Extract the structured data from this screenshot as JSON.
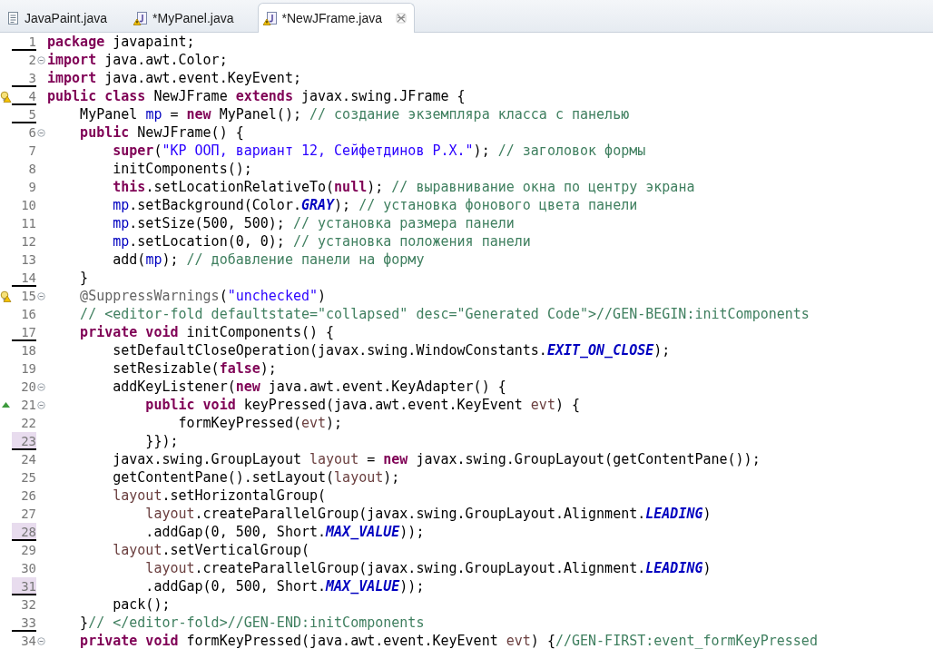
{
  "tabs": [
    {
      "label": "JavaPaint.java",
      "kind": "plain",
      "selected": false,
      "closable": false
    },
    {
      "label": "*MyPanel.java",
      "kind": "java",
      "selected": false,
      "closable": false
    },
    {
      "label": "*NewJFrame.java",
      "kind": "java",
      "selected": true,
      "closable": true
    }
  ],
  "editor": {
    "lines": [
      {
        "number": "1",
        "deletion_below": true,
        "changed": false,
        "foldable": false,
        "warning": false,
        "override": false,
        "segments": [
          {
            "kind": "keyword",
            "text": "package"
          },
          {
            "kind": "text",
            "text": " javapaint;"
          }
        ]
      },
      {
        "number": "2",
        "deletion_below": false,
        "changed": false,
        "foldable": true,
        "warning": false,
        "override": false,
        "segments": [
          {
            "kind": "keyword",
            "text": "import"
          },
          {
            "kind": "text",
            "text": " java.awt.Color;"
          }
        ]
      },
      {
        "number": "3",
        "deletion_below": true,
        "changed": false,
        "foldable": false,
        "warning": false,
        "override": false,
        "segments": [
          {
            "kind": "keyword",
            "text": "import"
          },
          {
            "kind": "text",
            "text": " java.awt.event.KeyEvent;"
          }
        ]
      },
      {
        "number": "4",
        "deletion_below": true,
        "changed": false,
        "foldable": false,
        "warning": true,
        "override": false,
        "segments": [
          {
            "kind": "keyword",
            "text": "public class"
          },
          {
            "kind": "text",
            "text": " NewJFrame "
          },
          {
            "kind": "keyword",
            "text": "extends"
          },
          {
            "kind": "text",
            "text": " javax.swing.JFrame {"
          }
        ]
      },
      {
        "number": "5",
        "deletion_below": true,
        "changed": false,
        "foldable": false,
        "warning": false,
        "override": false,
        "segments": [
          {
            "kind": "text",
            "text": "    MyPanel "
          },
          {
            "kind": "field",
            "text": "mp"
          },
          {
            "kind": "text",
            "text": " = "
          },
          {
            "kind": "keyword",
            "text": "new"
          },
          {
            "kind": "text",
            "text": " MyPanel(); "
          },
          {
            "kind": "comment",
            "text": "// создание экземпляра класса с панелью"
          }
        ]
      },
      {
        "number": "6",
        "deletion_below": false,
        "changed": false,
        "foldable": true,
        "warning": false,
        "override": false,
        "segments": [
          {
            "kind": "keyword",
            "text": "    public"
          },
          {
            "kind": "text",
            "text": " NewJFrame() {"
          }
        ]
      },
      {
        "number": "7",
        "deletion_below": false,
        "changed": false,
        "foldable": false,
        "warning": false,
        "override": false,
        "segments": [
          {
            "kind": "keyword",
            "text": "        super"
          },
          {
            "kind": "text",
            "text": "("
          },
          {
            "kind": "string",
            "text": "\"КР ООП, вариант 12, Сейфетдинов Р.Х.\""
          },
          {
            "kind": "text",
            "text": "); "
          },
          {
            "kind": "comment",
            "text": "// заголовок формы"
          }
        ]
      },
      {
        "number": "8",
        "deletion_below": false,
        "changed": false,
        "foldable": false,
        "warning": false,
        "override": false,
        "segments": [
          {
            "kind": "text",
            "text": "        initComponents();"
          }
        ]
      },
      {
        "number": "9",
        "deletion_below": false,
        "changed": false,
        "foldable": false,
        "warning": false,
        "override": false,
        "segments": [
          {
            "kind": "keyword",
            "text": "        this"
          },
          {
            "kind": "text",
            "text": ".setLocationRelativeTo("
          },
          {
            "kind": "keyword",
            "text": "null"
          },
          {
            "kind": "text",
            "text": "); "
          },
          {
            "kind": "comment",
            "text": "// выравнивание окна по центру экрана"
          }
        ]
      },
      {
        "number": "10",
        "deletion_below": false,
        "changed": false,
        "foldable": false,
        "warning": false,
        "override": false,
        "segments": [
          {
            "kind": "field",
            "text": "        mp"
          },
          {
            "kind": "text",
            "text": ".setBackground(Color."
          },
          {
            "kind": "constant",
            "text": "GRAY"
          },
          {
            "kind": "text",
            "text": "); "
          },
          {
            "kind": "comment",
            "text": "// установка фонового цвета панели"
          }
        ]
      },
      {
        "number": "11",
        "deletion_below": false,
        "changed": false,
        "foldable": false,
        "warning": false,
        "override": false,
        "segments": [
          {
            "kind": "field",
            "text": "        mp"
          },
          {
            "kind": "text",
            "text": ".setSize(500, 500); "
          },
          {
            "kind": "comment",
            "text": "// установка размера панели"
          }
        ]
      },
      {
        "number": "12",
        "deletion_below": false,
        "changed": false,
        "foldable": false,
        "warning": false,
        "override": false,
        "segments": [
          {
            "kind": "field",
            "text": "        mp"
          },
          {
            "kind": "text",
            "text": ".setLocation(0, 0); "
          },
          {
            "kind": "comment",
            "text": "// установка положения панели"
          }
        ]
      },
      {
        "number": "13",
        "deletion_below": false,
        "changed": false,
        "foldable": false,
        "warning": false,
        "override": false,
        "segments": [
          {
            "kind": "text",
            "text": "        add("
          },
          {
            "kind": "field",
            "text": "mp"
          },
          {
            "kind": "text",
            "text": "); "
          },
          {
            "kind": "comment",
            "text": "// добавление панели на форму"
          }
        ]
      },
      {
        "number": "14",
        "deletion_below": true,
        "changed": false,
        "foldable": false,
        "warning": false,
        "override": false,
        "segments": [
          {
            "kind": "text",
            "text": "    }"
          }
        ]
      },
      {
        "number": "15",
        "deletion_below": false,
        "changed": false,
        "foldable": true,
        "warning": true,
        "override": false,
        "segments": [
          {
            "kind": "annotation",
            "text": "    @SuppressWarnings"
          },
          {
            "kind": "text",
            "text": "("
          },
          {
            "kind": "string",
            "text": "\"unchecked\""
          },
          {
            "kind": "text",
            "text": ")"
          }
        ]
      },
      {
        "number": "16",
        "deletion_below": false,
        "changed": false,
        "foldable": false,
        "warning": false,
        "override": false,
        "segments": [
          {
            "kind": "comment",
            "text": "    // <editor-fold defaultstate=\"collapsed\" desc=\"Generated Code\">//GEN-BEGIN:initComponents"
          }
        ]
      },
      {
        "number": "17",
        "deletion_below": true,
        "changed": false,
        "foldable": false,
        "warning": false,
        "override": false,
        "segments": [
          {
            "kind": "keyword",
            "text": "    private void"
          },
          {
            "kind": "text",
            "text": " initComponents() {"
          }
        ]
      },
      {
        "number": "18",
        "deletion_below": false,
        "changed": false,
        "foldable": false,
        "warning": false,
        "override": false,
        "segments": [
          {
            "kind": "text",
            "text": "        setDefaultCloseOperation(javax.swing.WindowConstants."
          },
          {
            "kind": "constant",
            "text": "EXIT_ON_CLOSE"
          },
          {
            "kind": "text",
            "text": ");"
          }
        ]
      },
      {
        "number": "19",
        "deletion_below": false,
        "changed": false,
        "foldable": false,
        "warning": false,
        "override": false,
        "segments": [
          {
            "kind": "text",
            "text": "        setResizable("
          },
          {
            "kind": "keyword",
            "text": "false"
          },
          {
            "kind": "text",
            "text": ");"
          }
        ]
      },
      {
        "number": "20",
        "deletion_below": false,
        "changed": false,
        "foldable": true,
        "warning": false,
        "override": false,
        "segments": [
          {
            "kind": "text",
            "text": "        addKeyListener("
          },
          {
            "kind": "keyword",
            "text": "new"
          },
          {
            "kind": "text",
            "text": " java.awt.event.KeyAdapter() {"
          }
        ]
      },
      {
        "number": "21",
        "deletion_below": false,
        "changed": false,
        "foldable": true,
        "warning": false,
        "override": true,
        "segments": [
          {
            "kind": "keyword",
            "text": "            public void"
          },
          {
            "kind": "text",
            "text": " keyPressed(java.awt.event.KeyEvent "
          },
          {
            "kind": "local",
            "text": "evt"
          },
          {
            "kind": "text",
            "text": ") {"
          }
        ]
      },
      {
        "number": "22",
        "deletion_below": false,
        "changed": false,
        "foldable": false,
        "warning": false,
        "override": false,
        "segments": [
          {
            "kind": "text",
            "text": "                formKeyPressed("
          },
          {
            "kind": "local",
            "text": "evt"
          },
          {
            "kind": "text",
            "text": ");"
          }
        ]
      },
      {
        "number": "23",
        "deletion_below": true,
        "changed": true,
        "foldable": false,
        "warning": false,
        "override": false,
        "segments": [
          {
            "kind": "text",
            "text": "            }});"
          }
        ]
      },
      {
        "number": "24",
        "deletion_below": false,
        "changed": false,
        "foldable": false,
        "warning": false,
        "override": false,
        "segments": [
          {
            "kind": "text",
            "text": "        javax.swing.GroupLayout "
          },
          {
            "kind": "local",
            "text": "layout"
          },
          {
            "kind": "text",
            "text": " = "
          },
          {
            "kind": "keyword",
            "text": "new"
          },
          {
            "kind": "text",
            "text": " javax.swing.GroupLayout(getContentPane());"
          }
        ]
      },
      {
        "number": "25",
        "deletion_below": false,
        "changed": false,
        "foldable": false,
        "warning": false,
        "override": false,
        "segments": [
          {
            "kind": "text",
            "text": "        getContentPane().setLayout("
          },
          {
            "kind": "local",
            "text": "layout"
          },
          {
            "kind": "text",
            "text": ");"
          }
        ]
      },
      {
        "number": "26",
        "deletion_below": false,
        "changed": false,
        "foldable": false,
        "warning": false,
        "override": false,
        "segments": [
          {
            "kind": "local",
            "text": "        layout"
          },
          {
            "kind": "text",
            "text": ".setHorizontalGroup("
          }
        ]
      },
      {
        "number": "27",
        "deletion_below": false,
        "changed": false,
        "foldable": false,
        "warning": false,
        "override": false,
        "segments": [
          {
            "kind": "local",
            "text": "            layout"
          },
          {
            "kind": "text",
            "text": ".createParallelGroup(javax.swing.GroupLayout.Alignment."
          },
          {
            "kind": "constant",
            "text": "LEADING"
          },
          {
            "kind": "text",
            "text": ")"
          }
        ]
      },
      {
        "number": "28",
        "deletion_below": true,
        "changed": true,
        "foldable": false,
        "warning": false,
        "override": false,
        "segments": [
          {
            "kind": "text",
            "text": "            .addGap(0, 500, Short."
          },
          {
            "kind": "constant",
            "text": "MAX_VALUE"
          },
          {
            "kind": "text",
            "text": "));"
          }
        ]
      },
      {
        "number": "29",
        "deletion_below": false,
        "changed": false,
        "foldable": false,
        "warning": false,
        "override": false,
        "segments": [
          {
            "kind": "local",
            "text": "        layout"
          },
          {
            "kind": "text",
            "text": ".setVerticalGroup("
          }
        ]
      },
      {
        "number": "30",
        "deletion_below": false,
        "changed": false,
        "foldable": false,
        "warning": false,
        "override": false,
        "segments": [
          {
            "kind": "local",
            "text": "            layout"
          },
          {
            "kind": "text",
            "text": ".createParallelGroup(javax.swing.GroupLayout.Alignment."
          },
          {
            "kind": "constant",
            "text": "LEADING"
          },
          {
            "kind": "text",
            "text": ")"
          }
        ]
      },
      {
        "number": "31",
        "deletion_below": true,
        "changed": true,
        "foldable": false,
        "warning": false,
        "override": false,
        "segments": [
          {
            "kind": "text",
            "text": "            .addGap(0, 500, Short."
          },
          {
            "kind": "constant",
            "text": "MAX_VALUE"
          },
          {
            "kind": "text",
            "text": "));"
          }
        ]
      },
      {
        "number": "32",
        "deletion_below": false,
        "changed": false,
        "foldable": false,
        "warning": false,
        "override": false,
        "segments": [
          {
            "kind": "text",
            "text": "        pack();"
          }
        ]
      },
      {
        "number": "33",
        "deletion_below": true,
        "changed": false,
        "foldable": false,
        "warning": false,
        "override": false,
        "segments": [
          {
            "kind": "text",
            "text": "    }"
          },
          {
            "kind": "comment",
            "text": "// </editor-fold>//GEN-END:initComponents"
          }
        ]
      },
      {
        "number": "34",
        "deletion_below": false,
        "changed": false,
        "foldable": true,
        "warning": false,
        "override": false,
        "segments": [
          {
            "kind": "keyword",
            "text": "    private void"
          },
          {
            "kind": "text",
            "text": " formKeyPressed(java.awt.event.KeyEvent "
          },
          {
            "kind": "local",
            "text": "evt"
          },
          {
            "kind": "text",
            "text": ") {"
          },
          {
            "kind": "comment",
            "text": "//GEN-FIRST:event_formKeyPressed"
          }
        ]
      }
    ]
  }
}
